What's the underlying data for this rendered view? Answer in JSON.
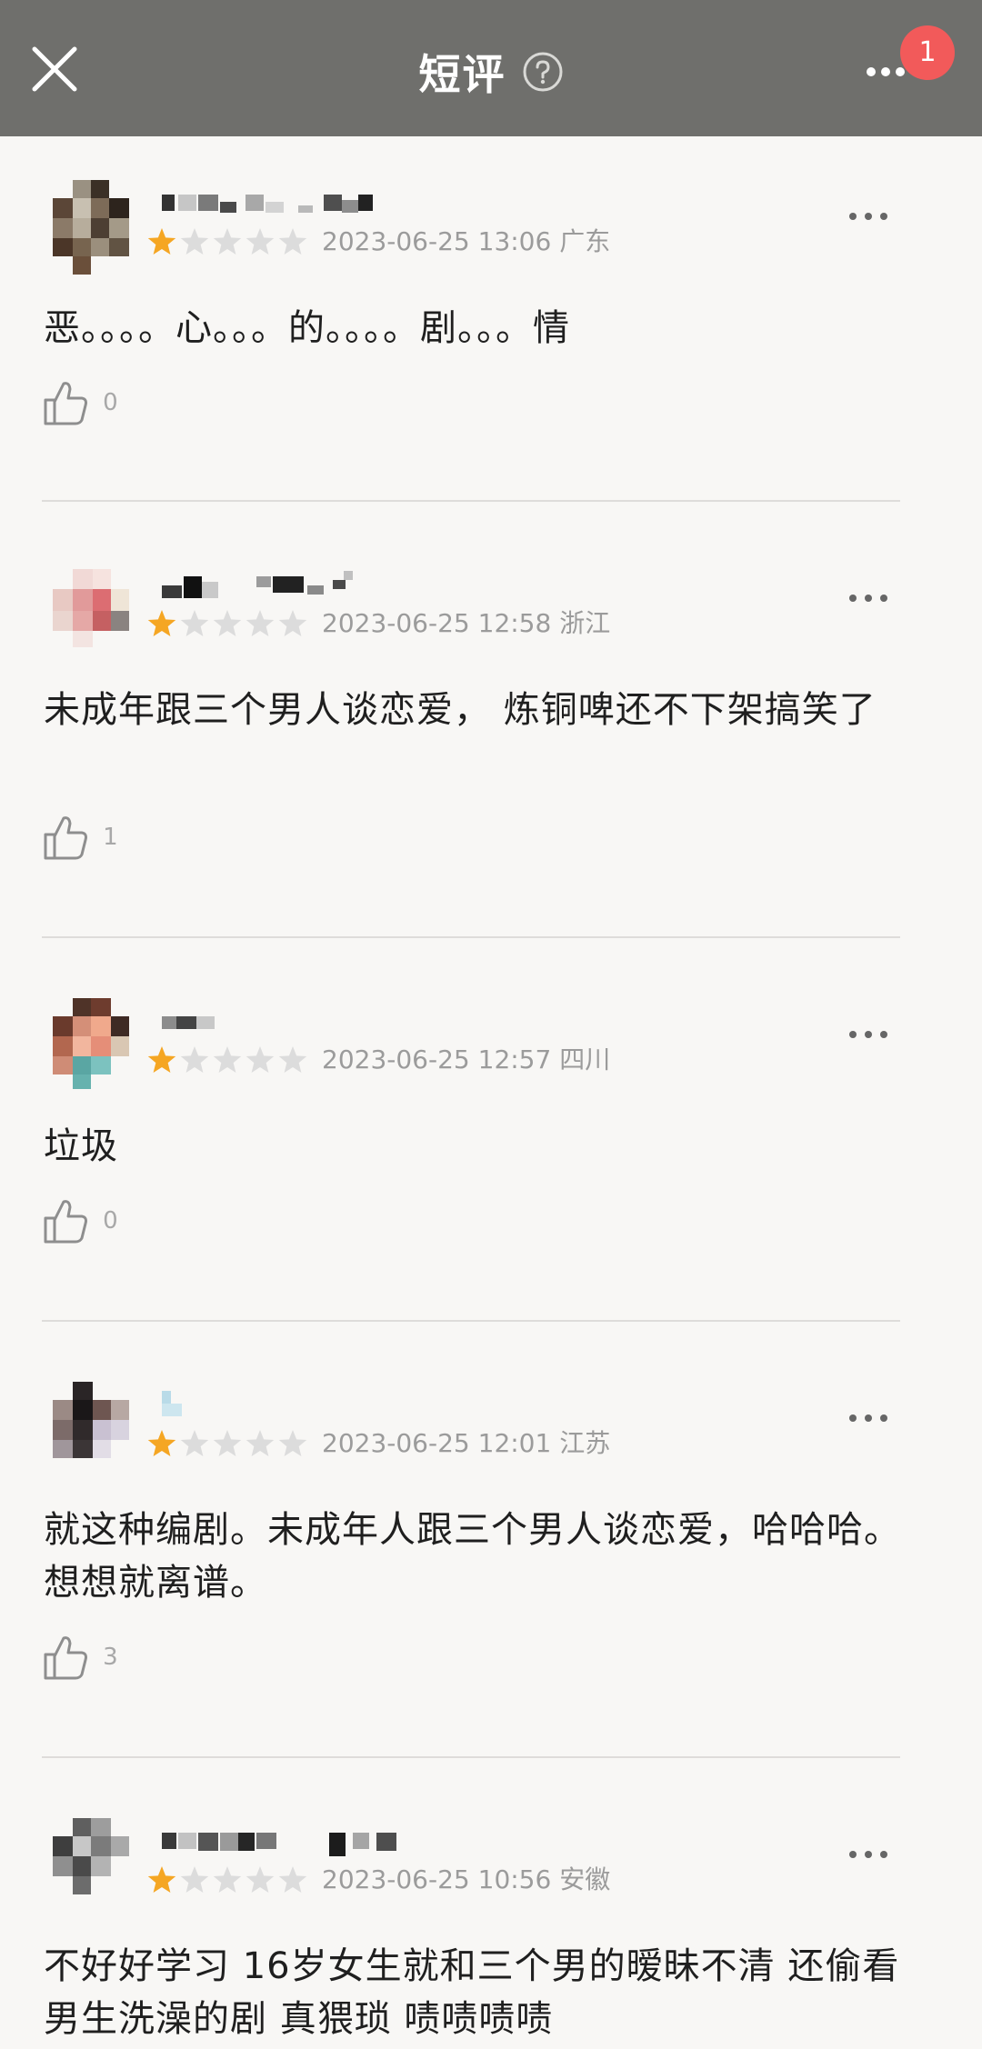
{
  "header": {
    "title": "短评",
    "badge_count": "1"
  },
  "colors": {
    "header_bg": "#6f6f6c",
    "badge": "#f25a5a",
    "star_filled": "#f5a623",
    "star_empty": "#dcdcdc",
    "meta_text": "#9b9b9b"
  },
  "reviews": [
    {
      "rating": 1,
      "meta": "2023-06-25 13:06 广东",
      "content": "恶。。。。心。。。的。。。。剧。。。情",
      "likes": "0"
    },
    {
      "rating": 1,
      "meta": "2023-06-25 12:58 浙江",
      "content": "未成年跟三个男人谈恋爱， 炼铜啤还不下架搞笑了",
      "likes": "1"
    },
    {
      "rating": 1,
      "meta": "2023-06-25 12:57 四川",
      "content": "垃圾",
      "likes": "0"
    },
    {
      "rating": 1,
      "meta": "2023-06-25 12:01 江苏",
      "content": "就这种编剧。未成年人跟三个男人谈恋爱，哈哈哈。想想就离谱。",
      "likes": "3"
    },
    {
      "rating": 1,
      "meta": "2023-06-25 10:56 安徽",
      "content": "不好好学习 16岁女生就和三个男的暧昧不清 还偷看男生洗澡的剧 真猥琐 啧啧啧啧",
      "likes": ""
    }
  ]
}
